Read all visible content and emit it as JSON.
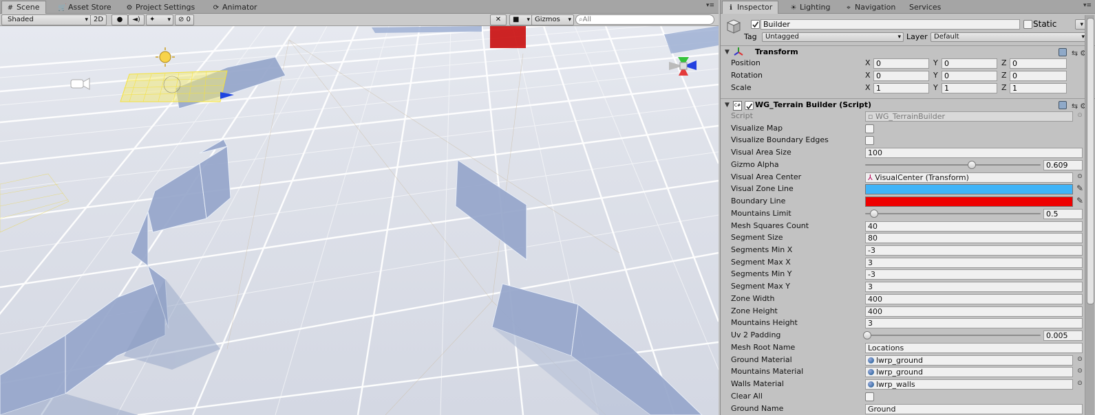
{
  "scene_tabs": [
    {
      "icon": "#",
      "label": "Scene"
    },
    {
      "icon": "🛒",
      "label": "Asset Store"
    },
    {
      "icon": "⚙",
      "label": "Project Settings"
    },
    {
      "icon": "⟳",
      "label": "Animator"
    }
  ],
  "scene_toolbar": {
    "shading": "Shaded",
    "mode_2d": "2D",
    "hidden_count": "0",
    "gizmos": "Gizmos",
    "search_placeholder": "All"
  },
  "inspector_tabs": [
    {
      "icon": "ℹ",
      "label": "Inspector"
    },
    {
      "icon": "☀",
      "label": "Lighting"
    },
    {
      "icon": "⌖",
      "label": "Navigation"
    },
    {
      "icon": "",
      "label": "Services"
    }
  ],
  "object": {
    "name": "Builder",
    "active": true,
    "static_label": "Static",
    "tag_label": "Tag",
    "tag_value": "Untagged",
    "layer_label": "Layer",
    "layer_value": "Default"
  },
  "transform": {
    "title": "Transform",
    "rows": [
      {
        "label": "Position",
        "x": "0",
        "y": "0",
        "z": "0"
      },
      {
        "label": "Rotation",
        "x": "0",
        "y": "0",
        "z": "0"
      },
      {
        "label": "Scale",
        "x": "1",
        "y": "1",
        "z": "1"
      }
    ]
  },
  "script_component": {
    "title": "WG_Terrain Builder (Script)",
    "script_label": "Script",
    "script_value": "WG_TerrainBuilder",
    "fields": {
      "visualize_map": {
        "label": "Visualize Map",
        "checked": false
      },
      "visualize_boundary_edges": {
        "label": "Visualize Boundary Edges",
        "checked": false
      },
      "visual_area_size": {
        "label": "Visual Area Size",
        "value": "100"
      },
      "gizmo_alpha": {
        "label": "Gizmo Alpha",
        "value": "0.609",
        "fraction": 0.609
      },
      "visual_area_center": {
        "label": "Visual Area Center",
        "value": "VisualCenter (Transform)"
      },
      "visual_zone_line": {
        "label": "Visual Zone Line",
        "color": "#40b4f8"
      },
      "boundary_line": {
        "label": "Boundary Line",
        "color": "#ee0000"
      },
      "mountains_limit": {
        "label": "Mountains Limit",
        "value": "0.5",
        "fraction": 0.05
      },
      "mesh_squares_count": {
        "label": "Mesh Squares Count",
        "value": "40"
      },
      "segment_size": {
        "label": "Segment Size",
        "value": "80"
      },
      "segments_min_x": {
        "label": "Segments Min X",
        "value": "-3"
      },
      "segment_max_x": {
        "label": "Segment Max X",
        "value": "3"
      },
      "segments_min_y": {
        "label": "Segments Min Y",
        "value": "-3"
      },
      "segment_max_y": {
        "label": "Segment Max Y",
        "value": "3"
      },
      "zone_width": {
        "label": "Zone Width",
        "value": "400"
      },
      "zone_height": {
        "label": "Zone Height",
        "value": "400"
      },
      "mountains_height": {
        "label": "Mountains Height",
        "value": "3"
      },
      "uv2_padding": {
        "label": "Uv 2 Padding",
        "value": "0.005",
        "fraction": 0.0
      },
      "mesh_root_name": {
        "label": "Mesh Root Name",
        "value": "Locations"
      },
      "ground_material": {
        "label": "Ground Material",
        "value": "lwrp_ground"
      },
      "mountains_material": {
        "label": "Mountains Material",
        "value": "lwrp_ground"
      },
      "walls_material": {
        "label": "Walls Material",
        "value": "lwrp_walls"
      },
      "clear_all": {
        "label": "Clear All",
        "checked": false
      },
      "ground_name": {
        "label": "Ground Name",
        "value": "Ground"
      }
    }
  }
}
